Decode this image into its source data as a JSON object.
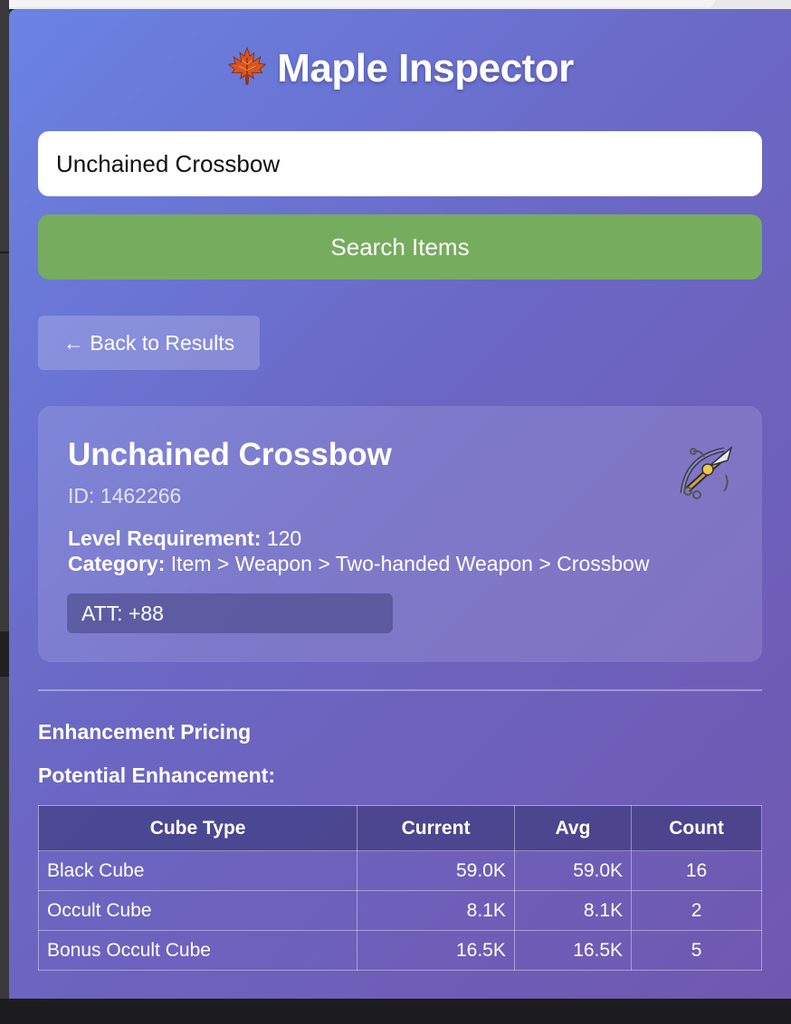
{
  "app": {
    "title": "Maple Inspector",
    "icon": "maple-leaf-icon",
    "colors": {
      "gradient_start": "#6a83e4",
      "gradient_end": "#7058b0",
      "search_button": "#76ac5e"
    }
  },
  "search": {
    "value": "Unchained Crossbow",
    "button_label": "Search Items"
  },
  "navigation": {
    "back_label": "← Back to Results"
  },
  "item": {
    "name": "Unchained Crossbow",
    "id_text": "ID: 1462266",
    "level_label": "Level Requirement:",
    "level_value": " 120",
    "category_label": "Category:",
    "category_value": " Item > Weapon > Two-handed Weapon > Crossbow",
    "stat": "ATT: +88",
    "icon": "crossbow-icon"
  },
  "pricing": {
    "section_title": "Enhancement Pricing",
    "potential_title": "Potential Enhancement:",
    "table": {
      "headers": [
        "Cube Type",
        "Current",
        "Avg",
        "Count"
      ],
      "rows": [
        [
          "Black Cube",
          "59.0K",
          "59.0K",
          "16"
        ],
        [
          "Occult Cube",
          "8.1K",
          "8.1K",
          "2"
        ],
        [
          "Bonus Occult Cube",
          "16.5K",
          "16.5K",
          "5"
        ]
      ]
    }
  }
}
